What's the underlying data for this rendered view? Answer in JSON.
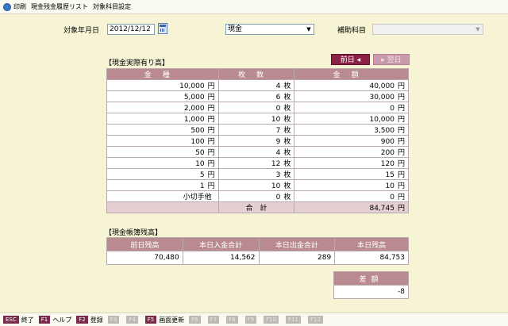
{
  "titlebar": {
    "menu_print": "印刷",
    "title": "現金残金履歴リスト",
    "menu_settings": "対象科目設定"
  },
  "filters": {
    "date_label": "対象年月日",
    "date_value": "2012/12/12",
    "account_value": "現金",
    "sub_label": "補助科目",
    "sub_value": ""
  },
  "cash_section": {
    "title": "【現金実際有り高】",
    "prev_button": "前日 ◂",
    "next_button": "▸ 翌日",
    "headers": [
      "金種",
      "枚数",
      "金額"
    ],
    "rows": [
      {
        "denom": "10,000",
        "unit": "円",
        "count": "4",
        "count_unit": "枚",
        "amount": "40,000",
        "amount_unit": "円"
      },
      {
        "denom": "5,000",
        "unit": "円",
        "count": "6",
        "count_unit": "枚",
        "amount": "30,000",
        "amount_unit": "円"
      },
      {
        "denom": "2,000",
        "unit": "円",
        "count": "0",
        "count_unit": "枚",
        "amount": "0",
        "amount_unit": "円"
      },
      {
        "denom": "1,000",
        "unit": "円",
        "count": "10",
        "count_unit": "枚",
        "amount": "10,000",
        "amount_unit": "円"
      },
      {
        "denom": "500",
        "unit": "円",
        "count": "7",
        "count_unit": "枚",
        "amount": "3,500",
        "amount_unit": "円"
      },
      {
        "denom": "100",
        "unit": "円",
        "count": "9",
        "count_unit": "枚",
        "amount": "900",
        "amount_unit": "円"
      },
      {
        "denom": "50",
        "unit": "円",
        "count": "4",
        "count_unit": "枚",
        "amount": "200",
        "amount_unit": "円"
      },
      {
        "denom": "10",
        "unit": "円",
        "count": "12",
        "count_unit": "枚",
        "amount": "120",
        "amount_unit": "円"
      },
      {
        "denom": "5",
        "unit": "円",
        "count": "3",
        "count_unit": "枚",
        "amount": "15",
        "amount_unit": "円"
      },
      {
        "denom": "1",
        "unit": "円",
        "count": "10",
        "count_unit": "枚",
        "amount": "10",
        "amount_unit": "円"
      },
      {
        "denom": "小切手他",
        "unit": "",
        "count": "0",
        "count_unit": "枚",
        "amount": "0",
        "amount_unit": "円"
      }
    ],
    "total_label": "合　計",
    "total_amount": "84,745",
    "total_unit": "円"
  },
  "ledger_section": {
    "title": "【現金帳簿残高】",
    "headers": [
      "前日残高",
      "本日入金合計",
      "本日出金合計",
      "本日残高"
    ],
    "values": [
      "70,480",
      "14,562",
      "289",
      "84,753"
    ]
  },
  "diff": {
    "header": "差額",
    "value": "-8"
  },
  "fkeys": [
    {
      "key": "ESC",
      "label": "終了",
      "enabled": true
    },
    {
      "key": "F1",
      "label": "ヘルプ",
      "enabled": true
    },
    {
      "key": "F2",
      "label": "登録",
      "enabled": true
    },
    {
      "key": "F3",
      "label": "",
      "enabled": false
    },
    {
      "key": "F4",
      "label": "",
      "enabled": false
    },
    {
      "key": "F5",
      "label": "画面更新",
      "enabled": true
    },
    {
      "key": "F6",
      "label": "",
      "enabled": false
    },
    {
      "key": "F7",
      "label": "",
      "enabled": false
    },
    {
      "key": "F8",
      "label": "",
      "enabled": false
    },
    {
      "key": "F9",
      "label": "",
      "enabled": false
    },
    {
      "key": "F10",
      "label": "",
      "enabled": false
    },
    {
      "key": "F11",
      "label": "",
      "enabled": false
    },
    {
      "key": "F12",
      "label": "",
      "enabled": false
    }
  ]
}
